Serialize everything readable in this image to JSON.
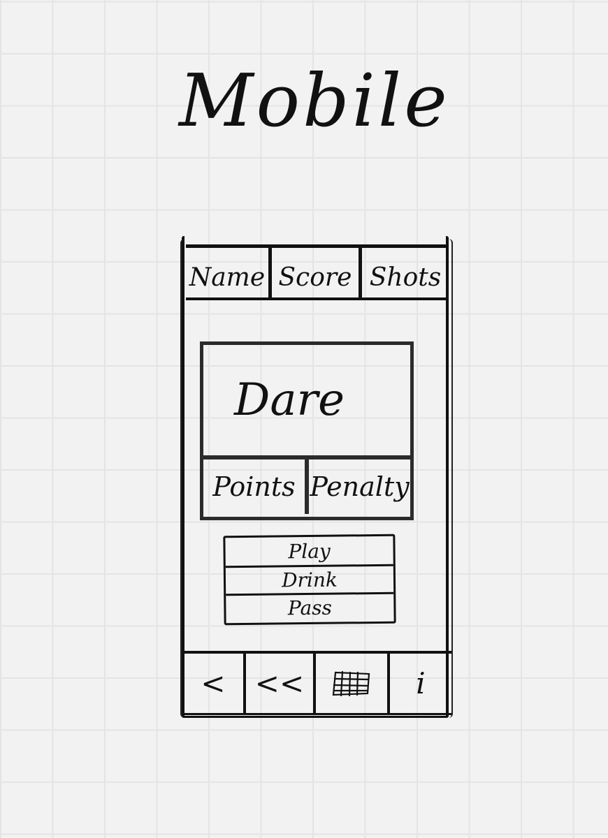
{
  "title": "Mobile",
  "header": {
    "columns": [
      "Name",
      "Score",
      "Shots"
    ]
  },
  "card": {
    "prompt": "Dare",
    "left_label": "Points",
    "right_label": "Penalty"
  },
  "actions": [
    "Play",
    "Drink",
    "Pass"
  ],
  "navbar": {
    "icons": [
      "back-icon",
      "rewind-icon",
      "grid-icon",
      "info-icon"
    ],
    "back_glyph": "<",
    "rewind_glyph": "<<",
    "info_glyph": "i"
  }
}
